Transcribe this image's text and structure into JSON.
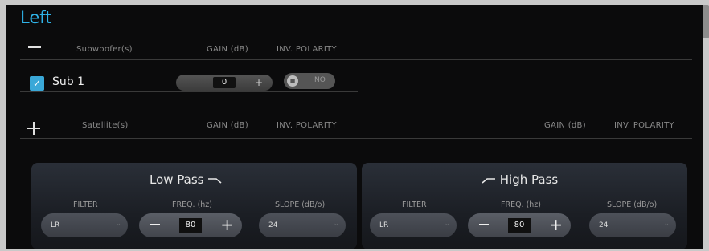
{
  "window": {
    "title": "Left"
  },
  "subwoofer_section": {
    "header_label": "Subwoofer(s)",
    "gain_header": "GAIN (dB)",
    "polarity_header": "INV. POLARITY",
    "rows": [
      {
        "label": "Sub 1",
        "checked": true,
        "gain_value": "0",
        "gain_minus": "–",
        "gain_plus": "+",
        "polarity_state": "NO"
      }
    ]
  },
  "satellite_section": {
    "header_label": "Satellite(s)",
    "gain_header": "GAIN (dB)",
    "polarity_header": "INV. POLARITY",
    "gain_header_right": "GAIN (dB)",
    "polarity_header_right": "INV. POLARITY"
  },
  "low_pass": {
    "title": "Low Pass",
    "filter_label": "FILTER",
    "filter_value": "LR",
    "freq_label": "FREQ. (hz)",
    "freq_value": "80",
    "slope_label": "SLOPE (dB/o)",
    "slope_value": "24"
  },
  "high_pass": {
    "title": "High Pass",
    "filter_label": "FILTER",
    "filter_value": "LR",
    "freq_label": "FREQ. (hz)",
    "freq_value": "80",
    "slope_label": "SLOPE (dB/o)",
    "slope_value": "24"
  },
  "icons": {
    "collapse": "minus-icon",
    "expand": "plus-icon",
    "check": "check-icon",
    "chevron": "chevron-down-icon"
  },
  "colors": {
    "accent": "#2fb3e8",
    "background": "#0b0b0c",
    "panel": "#2a2f38"
  }
}
